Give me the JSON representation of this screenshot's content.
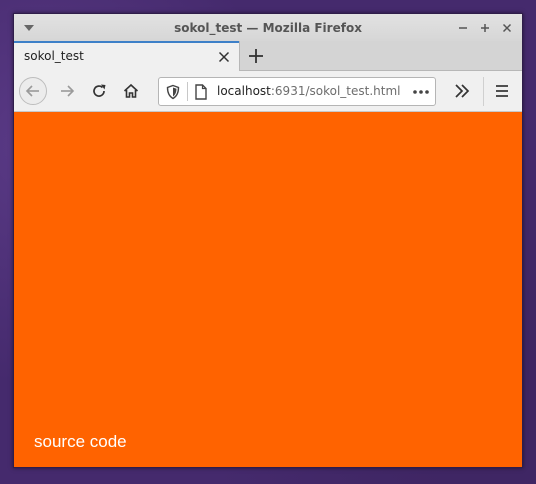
{
  "window": {
    "title": "sokol_test — Mozilla Firefox"
  },
  "tabs": [
    {
      "label": "sokol_test",
      "active": true
    }
  ],
  "urlbar": {
    "host": "localhost",
    "rest": ":6931/sokol_test.html"
  },
  "content": {
    "background": "#ff6300",
    "link_label": "source code"
  },
  "icons": {
    "window_menu": "chevron-down-icon",
    "minimize": "minimize-icon",
    "maximize": "maximize-icon",
    "close": "close-icon",
    "tab_close": "close-icon",
    "new_tab": "plus-icon",
    "back": "arrow-left-icon",
    "forward": "arrow-right-icon",
    "reload": "reload-icon",
    "home": "home-icon",
    "tracking": "shield-icon",
    "page": "page-icon",
    "page_actions": "more-horizontal-icon",
    "overflow": "chevron-double-right-icon",
    "menu": "hamburger-icon"
  }
}
